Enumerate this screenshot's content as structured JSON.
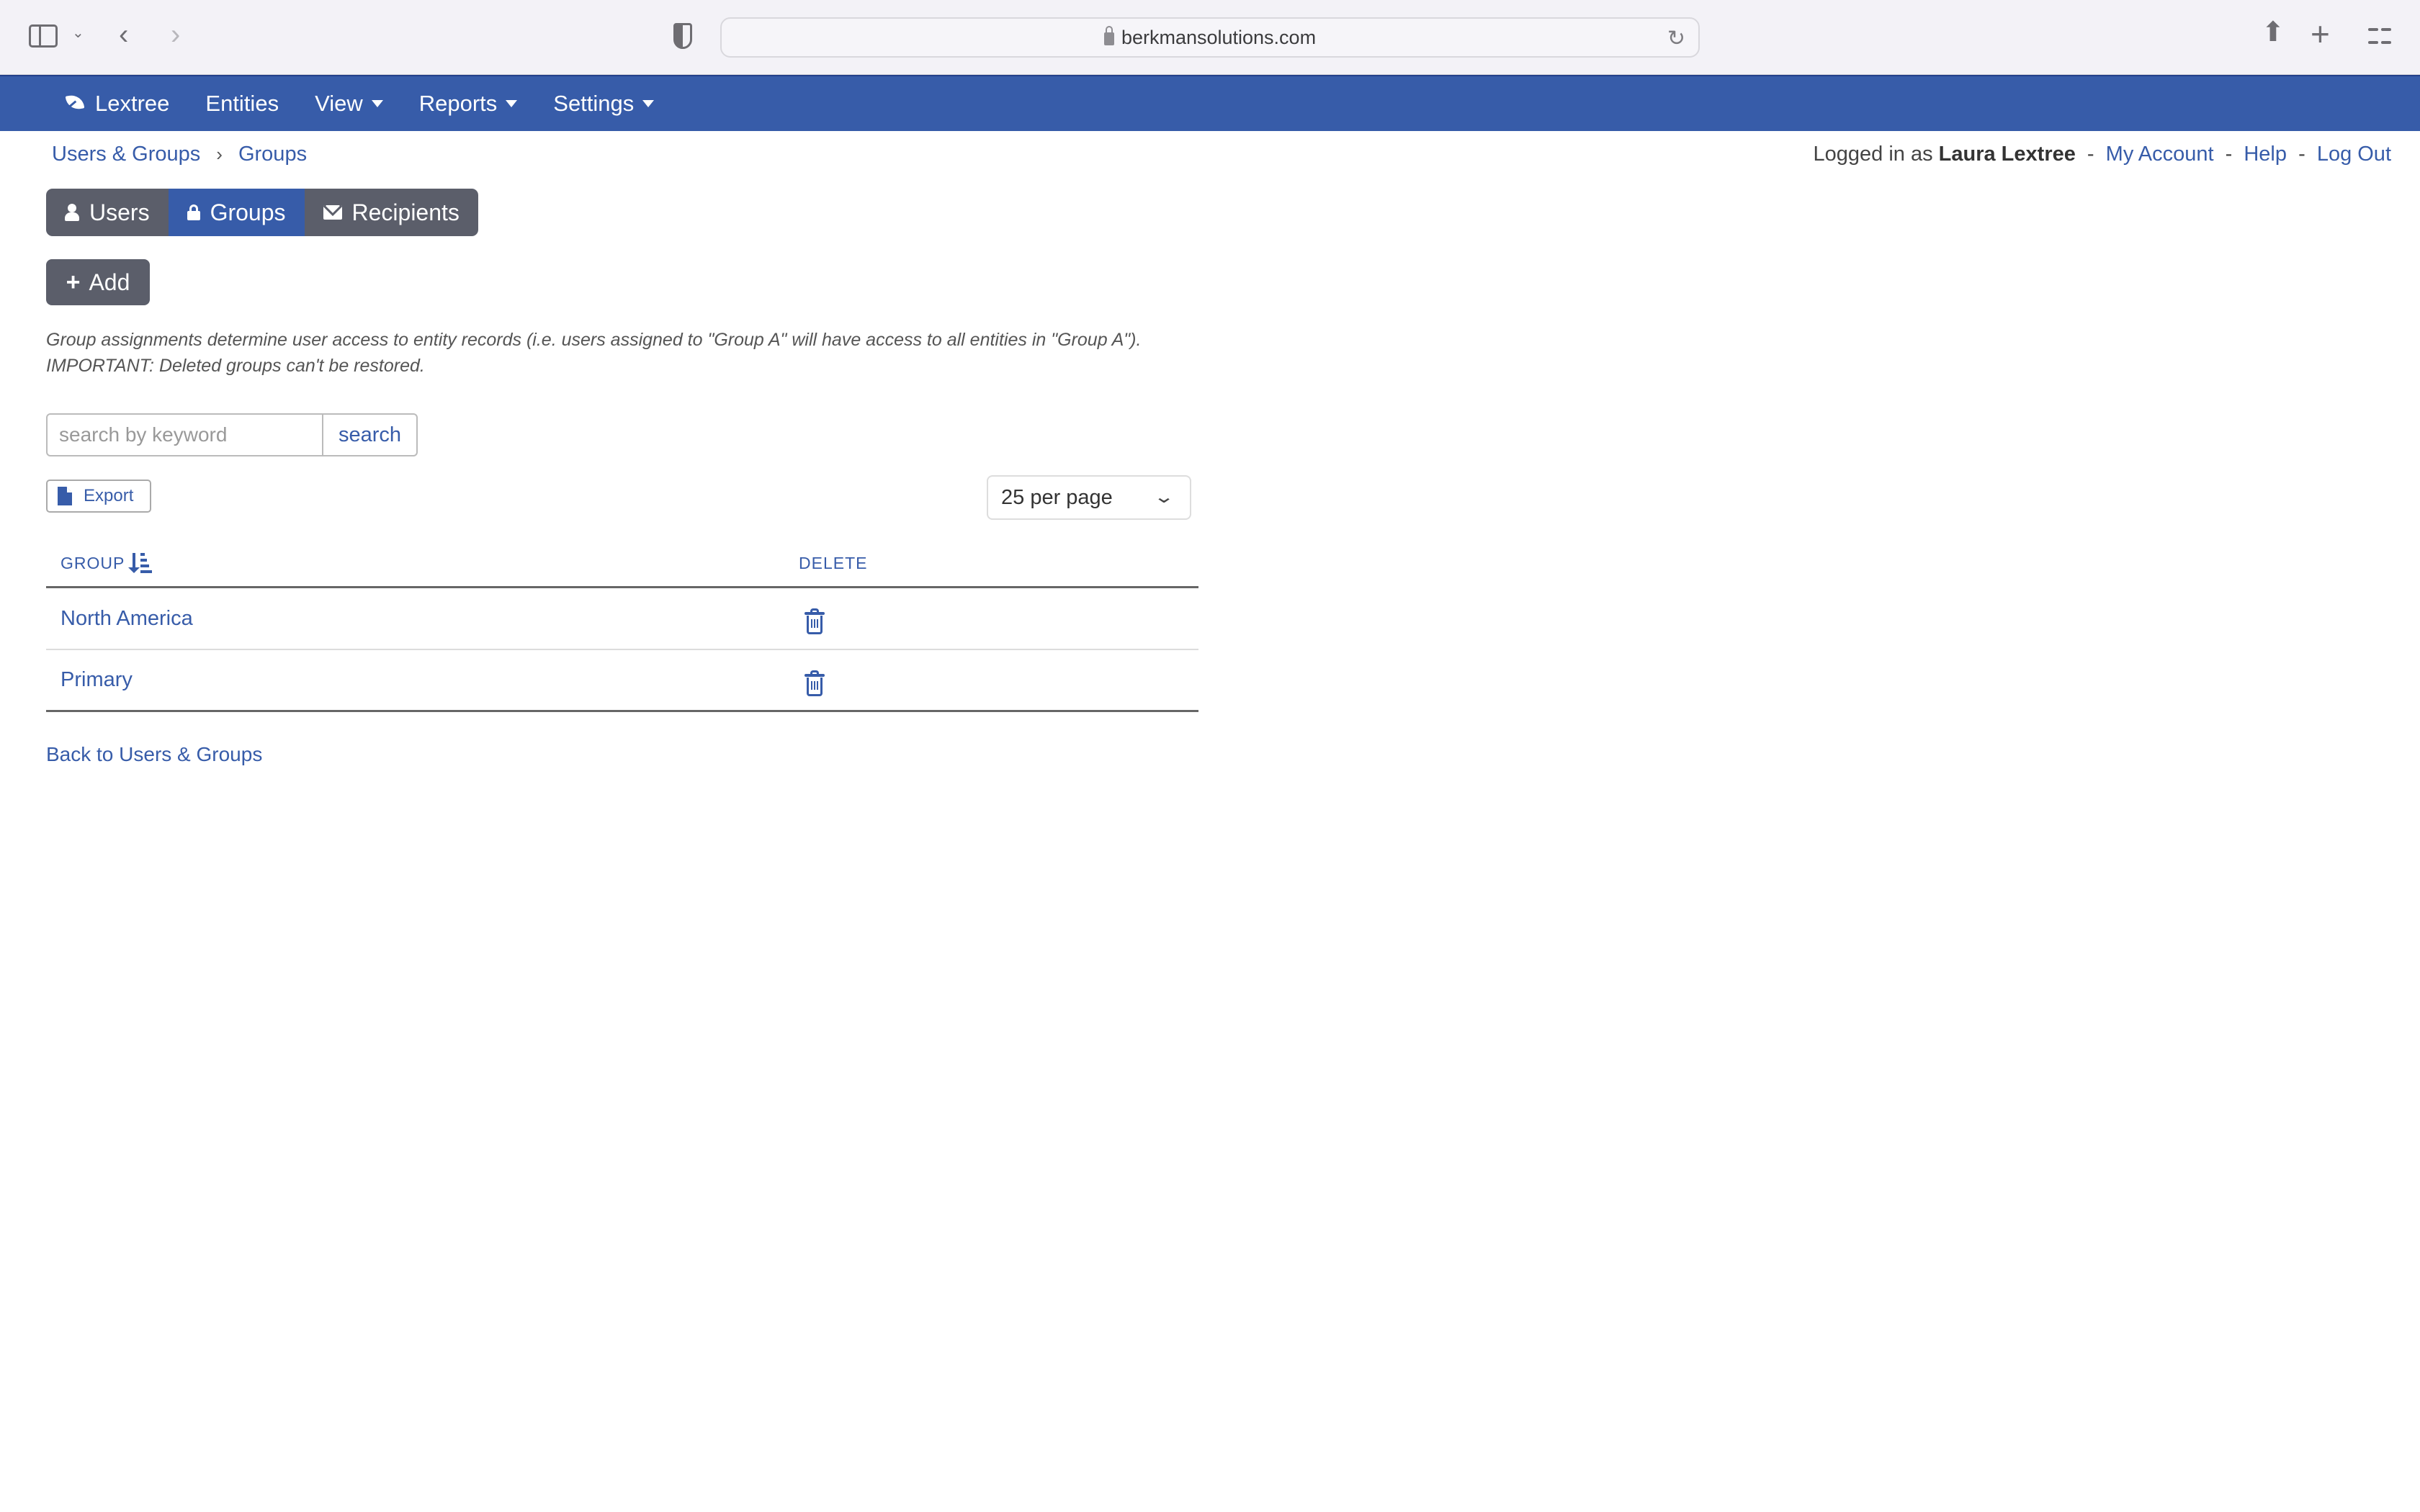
{
  "browser": {
    "url": "berkmansolutions.com",
    "icons": [
      "sidebar-toggle-icon",
      "chevron-down-icon",
      "back-icon",
      "forward-icon",
      "privacy-shield-icon",
      "lock-icon",
      "reload-icon",
      "share-icon",
      "new-tab-icon",
      "tab-overview-icon"
    ]
  },
  "nav": {
    "brand": "Lextree",
    "items": [
      {
        "label": "Entities",
        "dropdown": false
      },
      {
        "label": "View",
        "dropdown": true
      },
      {
        "label": "Reports",
        "dropdown": true
      },
      {
        "label": "Settings",
        "dropdown": true
      }
    ]
  },
  "breadcrumb": [
    "Users & Groups",
    "Groups"
  ],
  "account": {
    "prefix": "Logged in as",
    "user": "Laura Lextree",
    "sep": "-",
    "links": [
      "My Account",
      "Help",
      "Log Out"
    ]
  },
  "tabs": [
    {
      "label": "Users",
      "icon": "user-icon",
      "active": false
    },
    {
      "label": "Groups",
      "icon": "lock-icon",
      "active": true
    },
    {
      "label": "Recipients",
      "icon": "envelope-icon",
      "active": false
    }
  ],
  "add_button": {
    "label": "Add",
    "icon": "plus-icon"
  },
  "description": {
    "line1": "Group assignments determine user access to entity records (i.e. users assigned to \"Group A\" will have access to all entities in \"Group A\").",
    "line2": "IMPORTANT: Deleted groups can't be restored."
  },
  "search": {
    "placeholder": "search by keyword",
    "value": "",
    "button": "search"
  },
  "export": {
    "label": "Export",
    "icon": "file-icon"
  },
  "per_page": {
    "selected": "25 per page"
  },
  "table": {
    "columns": [
      {
        "label": "GROUP",
        "sort": "ascending"
      },
      {
        "label": "DELETE"
      }
    ],
    "rows": [
      {
        "group": "North America"
      },
      {
        "group": "Primary"
      }
    ]
  },
  "back_link": "Back to Users & Groups",
  "colors": {
    "brand": "#375ca9",
    "tab_inactive": "#5b5e6a",
    "link": "#375ca9"
  }
}
